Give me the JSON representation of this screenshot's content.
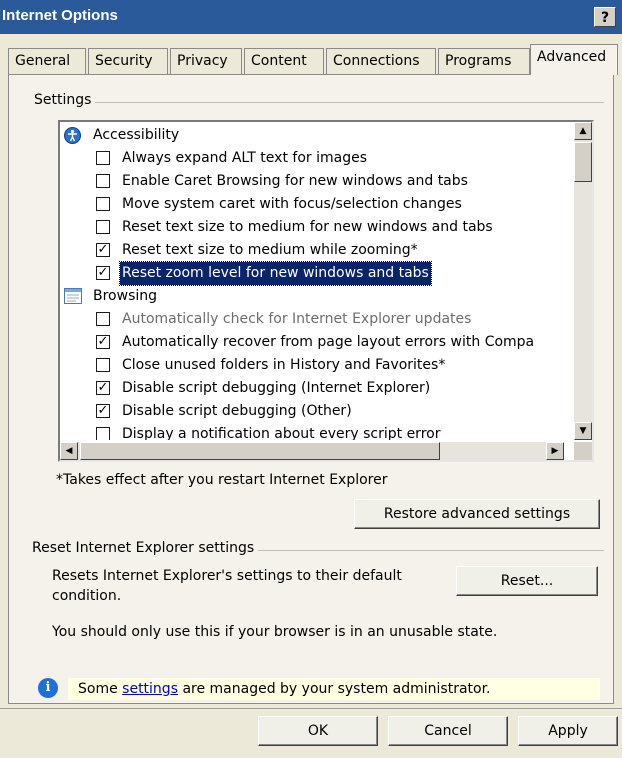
{
  "window": {
    "title": "Internet Options",
    "help_label": "?"
  },
  "tabs": [
    {
      "label": "General"
    },
    {
      "label": "Security"
    },
    {
      "label": "Privacy"
    },
    {
      "label": "Content"
    },
    {
      "label": "Connections"
    },
    {
      "label": "Programs"
    },
    {
      "label": "Advanced",
      "active": true
    }
  ],
  "settings": {
    "group_label": "Settings",
    "rows": [
      {
        "kind": "category",
        "icon": "accessibility-icon",
        "label": "Accessibility"
      },
      {
        "kind": "option",
        "checked": false,
        "label": "Always expand ALT text for images"
      },
      {
        "kind": "option",
        "checked": false,
        "label": "Enable Caret Browsing for new windows and tabs"
      },
      {
        "kind": "option",
        "checked": false,
        "label": "Move system caret with focus/selection changes"
      },
      {
        "kind": "option",
        "checked": false,
        "label": "Reset text size to medium for new windows and tabs"
      },
      {
        "kind": "option",
        "checked": true,
        "label": "Reset text size to medium while zooming*"
      },
      {
        "kind": "option",
        "checked": true,
        "selected": true,
        "label": "Reset zoom level for new windows and tabs"
      },
      {
        "kind": "category",
        "icon": "browsing-icon",
        "label": "Browsing"
      },
      {
        "kind": "option",
        "checked": false,
        "disabled": true,
        "label": "Automatically check for Internet Explorer updates"
      },
      {
        "kind": "option",
        "checked": true,
        "label": "Automatically recover from page layout errors with Compa"
      },
      {
        "kind": "option",
        "checked": false,
        "label": "Close unused folders in History and Favorites*"
      },
      {
        "kind": "option",
        "checked": true,
        "label": "Disable script debugging (Internet Explorer)"
      },
      {
        "kind": "option",
        "checked": true,
        "label": "Disable script debugging (Other)"
      },
      {
        "kind": "option",
        "checked": false,
        "label": "Display a notification about every script error"
      }
    ],
    "restart_note": "*Takes effect after you restart Internet Explorer",
    "restore_button": "Restore advanced settings"
  },
  "reset": {
    "group_label": "Reset Internet Explorer settings",
    "description": "Resets Internet Explorer's settings to their default",
    "description2": "condition.",
    "button": "Reset...",
    "warning": "You should only use this if your browser is in an unusable state."
  },
  "info": {
    "icon": "info-icon",
    "prefix": "Some ",
    "link": "settings",
    "suffix": " are managed by your system administrator."
  },
  "footer": {
    "ok": "OK",
    "cancel": "Cancel",
    "apply": "Apply"
  }
}
